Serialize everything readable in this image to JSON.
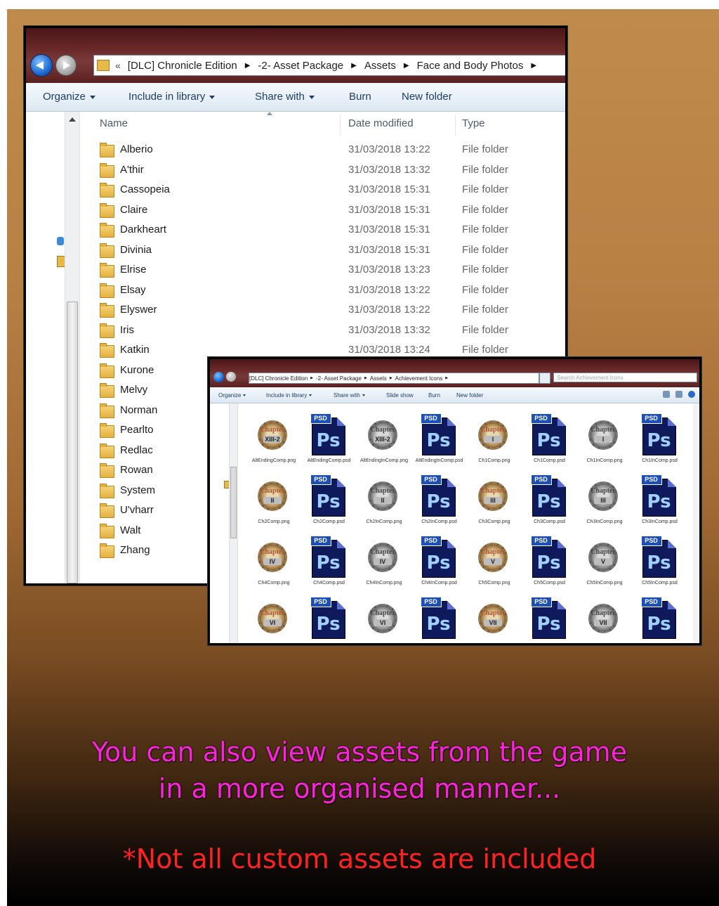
{
  "window1": {
    "address": [
      "[DLC] Chronicle Edition",
      "-2- Asset Package",
      "Assets",
      "Face and Body Photos"
    ],
    "address_prefix": "«",
    "toolbar": [
      {
        "label": "Organize",
        "dropdown": true
      },
      {
        "label": "Include in library",
        "dropdown": true
      },
      {
        "label": "Share with",
        "dropdown": true
      },
      {
        "label": "Burn",
        "dropdown": false
      },
      {
        "label": "New folder",
        "dropdown": false
      }
    ],
    "columns": {
      "name": "Name",
      "date": "Date modified",
      "type": "Type"
    },
    "rows": [
      {
        "name": "Alberio",
        "date": "31/03/2018 13:22",
        "type": "File folder"
      },
      {
        "name": "A'thir",
        "date": "31/03/2018 13:32",
        "type": "File folder"
      },
      {
        "name": "Cassopeia",
        "date": "31/03/2018 15:31",
        "type": "File folder"
      },
      {
        "name": "Claire",
        "date": "31/03/2018 15:31",
        "type": "File folder"
      },
      {
        "name": "Darkheart",
        "date": "31/03/2018 15:31",
        "type": "File folder"
      },
      {
        "name": "Divinia",
        "date": "31/03/2018 15:31",
        "type": "File folder"
      },
      {
        "name": "Elrise",
        "date": "31/03/2018 13:23",
        "type": "File folder"
      },
      {
        "name": "Elsay",
        "date": "31/03/2018 13:22",
        "type": "File folder"
      },
      {
        "name": "Elyswer",
        "date": "31/03/2018 13:22",
        "type": "File folder"
      },
      {
        "name": "Iris",
        "date": "31/03/2018 13:32",
        "type": "File folder"
      },
      {
        "name": "Katkin",
        "date": "31/03/2018 13:24",
        "type": "File folder"
      },
      {
        "name": "Kurone",
        "date": "",
        "type": ""
      },
      {
        "name": "Melvy",
        "date": "",
        "type": ""
      },
      {
        "name": "Norman",
        "date": "",
        "type": ""
      },
      {
        "name": "Pearlto",
        "date": "",
        "type": ""
      },
      {
        "name": "Redlac",
        "date": "",
        "type": ""
      },
      {
        "name": "Rowan",
        "date": "",
        "type": ""
      },
      {
        "name": "System",
        "date": "",
        "type": ""
      },
      {
        "name": "U'vharr",
        "date": "",
        "type": ""
      },
      {
        "name": "Walt",
        "date": "",
        "type": ""
      },
      {
        "name": "Zhang",
        "date": "",
        "type": ""
      }
    ]
  },
  "window2": {
    "address": [
      "[DLC] Chronicle Edition",
      "-2- Asset Package",
      "Assets",
      "Achievement Icons"
    ],
    "search_placeholder": "Search Achievement Icons",
    "toolbar": [
      {
        "label": "Organize",
        "dropdown": true
      },
      {
        "label": "Include in library",
        "dropdown": true
      },
      {
        "label": "Share with",
        "dropdown": true
      },
      {
        "label": "Slide show",
        "dropdown": false
      },
      {
        "label": "Burn",
        "dropdown": false
      },
      {
        "label": "New folder",
        "dropdown": false
      }
    ],
    "files": [
      {
        "kind": "chapter",
        "chapter": "XIII-2",
        "label": "AltEndingComp.png",
        "color": true
      },
      {
        "kind": "psd",
        "label": "AltEndingComp.psd"
      },
      {
        "kind": "chapter",
        "chapter": "XIII-2",
        "label": "AltEndingInComp.png",
        "color": false
      },
      {
        "kind": "psd",
        "label": "AltEndingInComp.psd"
      },
      {
        "kind": "chapter",
        "chapter": "I",
        "label": "Ch1Comp.png",
        "color": true
      },
      {
        "kind": "psd",
        "label": "Ch1Comp.psd"
      },
      {
        "kind": "chapter",
        "chapter": "I",
        "label": "Ch1InComp.png",
        "color": false
      },
      {
        "kind": "psd",
        "label": "Ch1InComp.psd"
      },
      {
        "kind": "chapter",
        "chapter": "II",
        "label": "Ch2Comp.png",
        "color": true
      },
      {
        "kind": "psd",
        "label": "Ch2Comp.psd"
      },
      {
        "kind": "chapter",
        "chapter": "II",
        "label": "Ch2InComp.png",
        "color": false
      },
      {
        "kind": "psd",
        "label": "Ch2InComp.psd"
      },
      {
        "kind": "chapter",
        "chapter": "III",
        "label": "Ch3Comp.png",
        "color": true
      },
      {
        "kind": "psd",
        "label": "Ch3Comp.psd"
      },
      {
        "kind": "chapter",
        "chapter": "III",
        "label": "Ch3InComp.png",
        "color": false
      },
      {
        "kind": "psd",
        "label": "Ch3InComp.psd"
      },
      {
        "kind": "chapter",
        "chapter": "IV",
        "label": "Ch4Comp.png",
        "color": true
      },
      {
        "kind": "psd",
        "label": "Ch4Comp.psd"
      },
      {
        "kind": "chapter",
        "chapter": "IV",
        "label": "Ch4InComp.png",
        "color": false
      },
      {
        "kind": "psd",
        "label": "Ch4InComp.psd"
      },
      {
        "kind": "chapter",
        "chapter": "V",
        "label": "Ch5Comp.png",
        "color": true
      },
      {
        "kind": "psd",
        "label": "Ch5Comp.psd"
      },
      {
        "kind": "chapter",
        "chapter": "V",
        "label": "Ch5InComp.png",
        "color": false
      },
      {
        "kind": "psd",
        "label": "Ch5InComp.psd"
      },
      {
        "kind": "chapter",
        "chapter": "VI",
        "label": "",
        "color": true
      },
      {
        "kind": "psd",
        "label": ""
      },
      {
        "kind": "chapter",
        "chapter": "VI",
        "label": "",
        "color": false
      },
      {
        "kind": "psd",
        "label": ""
      },
      {
        "kind": "chapter",
        "chapter": "VII",
        "label": "",
        "color": true
      },
      {
        "kind": "psd",
        "label": ""
      },
      {
        "kind": "chapter",
        "chapter": "VII",
        "label": "",
        "color": false
      },
      {
        "kind": "psd",
        "label": ""
      }
    ],
    "psd_tag": "PSD",
    "ps_text": "Ps",
    "chapter_word": "Chapter"
  },
  "captions": {
    "line1": "You can also view assets from the game",
    "line2": "in a more organised manner...",
    "note": "*Not all custom assets are included"
  },
  "colors": {
    "caption_main": "#ff22dd",
    "caption_note": "#ff2222",
    "titlebar": "#6c2a2a",
    "psd_page": "#0f1a5c"
  }
}
